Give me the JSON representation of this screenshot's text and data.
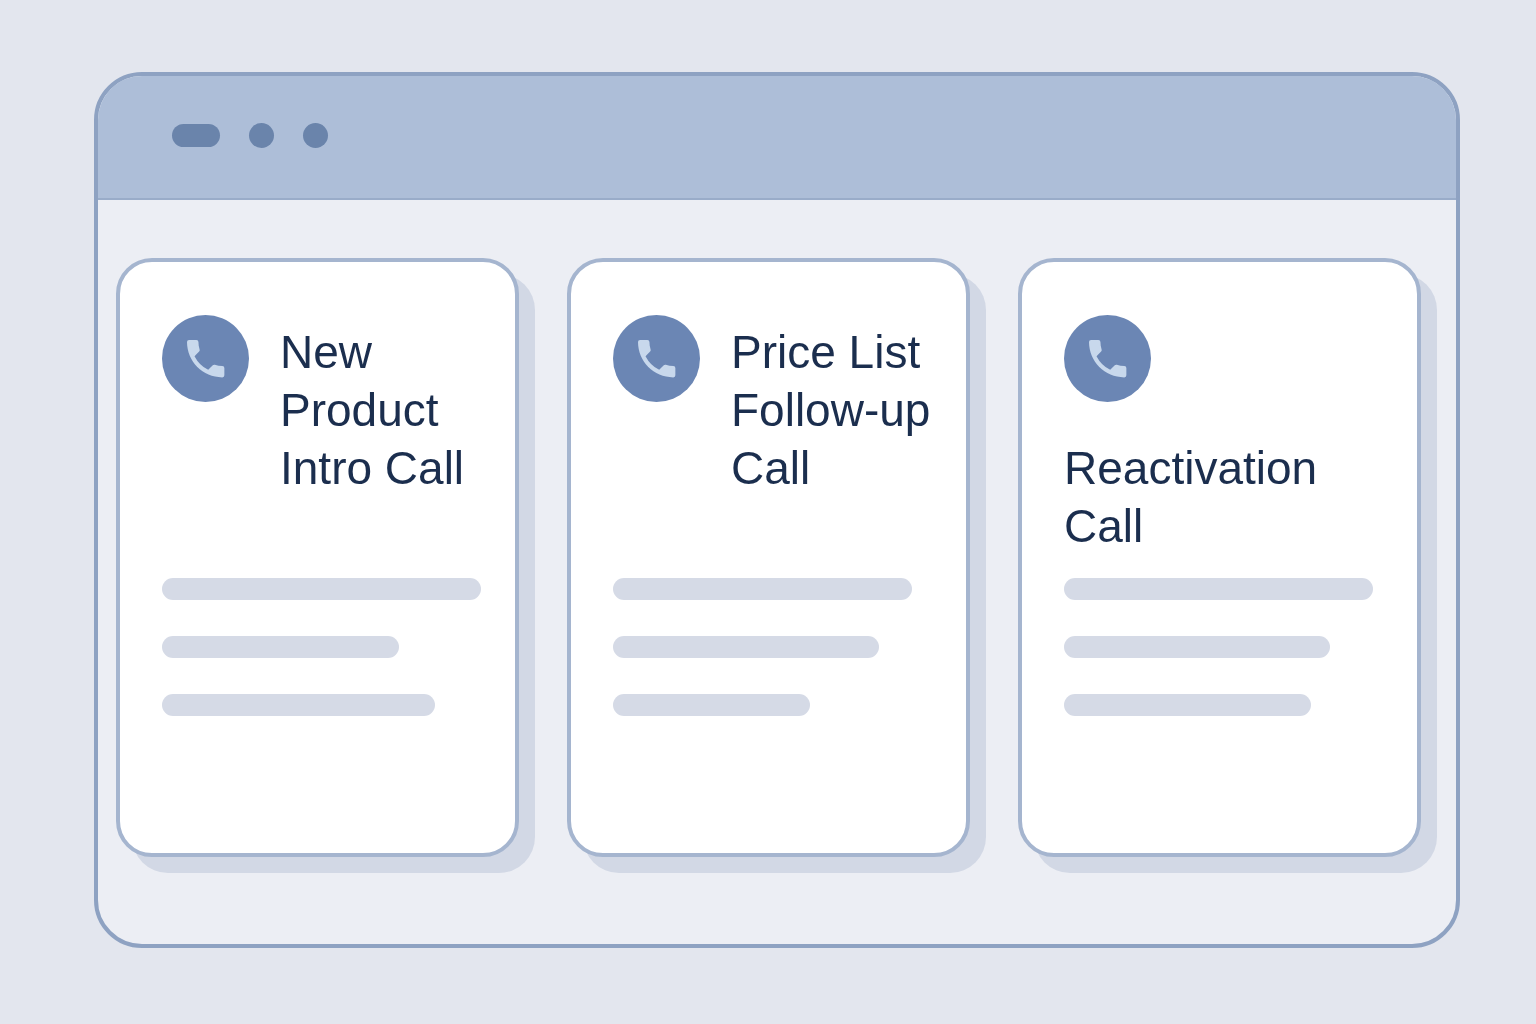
{
  "cards": [
    {
      "title": "New Product Intro Call"
    },
    {
      "title": "Price List Follow-up Call"
    },
    {
      "title": "Reactivation Call"
    }
  ]
}
